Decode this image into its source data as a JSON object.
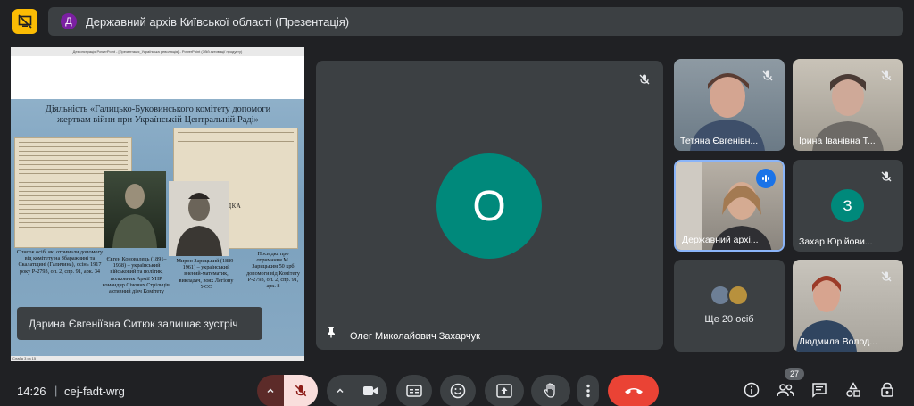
{
  "meeting": {
    "avatar_letter": "Д",
    "title": "Державний архів Київської області (Презентація)"
  },
  "presentation": {
    "window_title": "Демонстрація PowerPoint - [Презентація_Українська революція] - PowerPoint (Збій активації продукту)",
    "status_text": "Слайд 3 из 15",
    "heading": "Діяльність «Галицько-Буковинського комітету допомоги жертвам війни при Українській Центральній Раді»",
    "doc_stamp": "ПОСВІДКА",
    "captions": [
      "Список осіб, які отримали допомогу від комітету на Збаражчині та Скалатщині (Галичина), осінь 1917 року Р-2793, оп. 2, спр. 91, арк. 34",
      "Євген Коновалець (1891–1938) – український військовий та політик, полковник Армії УНР, командир Січових Стрільців, активний діяч Комітету",
      "Мирон Зарицький (1889–1961) – український вчений-математик, викладач, воях Легіону УСС",
      "Посвідка про отримання М. Зарицьким 50 крб допомоги від Комітету Р-2793, оп. 2, спр. 91, арк. 8"
    ]
  },
  "toast": {
    "text": "Дарина Євгеніївна Ситюк залишає зустріч"
  },
  "main_tile": {
    "avatar_letter": "О",
    "name": "Олег Миколайович Захарчук",
    "avatar_color": "#00897b"
  },
  "tiles": [
    {
      "name": "Тетяна Євгенівн..."
    },
    {
      "name": "Ірина Іванівна Т..."
    },
    {
      "name": "Державний архі..."
    },
    {
      "name": "Захар Юрійови...",
      "avatar_letter": "З"
    },
    {
      "more_text": "Ще 20 осіб"
    },
    {
      "name": "Людмила Волод..."
    }
  ],
  "bottom": {
    "time": "14:26",
    "separator": "|",
    "meeting_code": "cej-fadt-wrg",
    "participants_count": "27"
  },
  "colors": {
    "accent_yellow": "#fbbc04",
    "end_call_red": "#ea4335",
    "muted_red_bg": "#f9dedc",
    "active_blue": "#8ab4f8"
  }
}
